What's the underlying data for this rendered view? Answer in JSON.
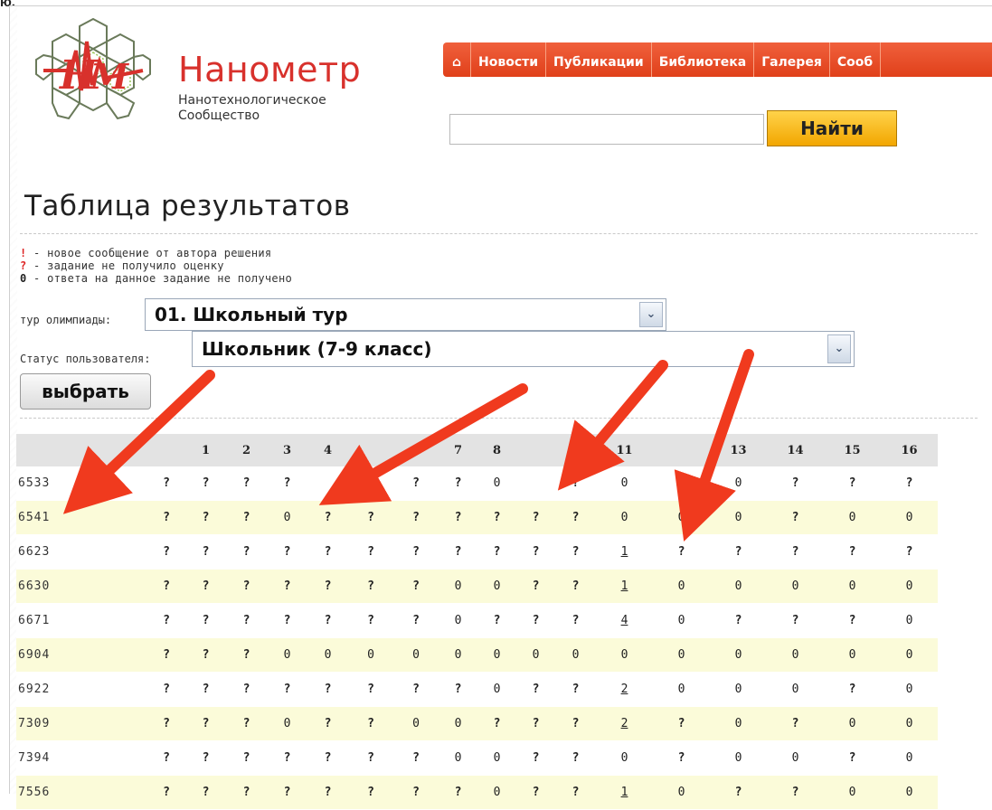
{
  "page": {
    "colors": {
      "accent": "#d8312c",
      "nav": "#e84c22",
      "row_alt": "#fbfbd9",
      "mark_red": "#dd2222",
      "link": "#2233bb"
    }
  },
  "header": {
    "stub_text": "ю.",
    "brand": "Нанометр",
    "brand_sub_line1": "Нанотехнологическое",
    "brand_sub_line2": "Сообщество",
    "logo_icon": "nanometer-logo"
  },
  "nav": {
    "home_icon": "home-icon",
    "items": [
      "Новости",
      "Публикации",
      "Библиотека",
      "Галерея",
      "Сооб"
    ]
  },
  "search": {
    "value": "",
    "button_label": "Найти"
  },
  "main": {
    "title": "Таблица результатов",
    "legend": [
      {
        "mark": "!",
        "text": " - новое сообщение от автора решения"
      },
      {
        "mark": "?",
        "text": " - задание не получило оценку"
      },
      {
        "mark": "0",
        "text": " - ответа на данное задание не получено"
      }
    ],
    "filter_round_label": "тур олимпиады:",
    "filter_round_value": "01. Школьный тур",
    "filter_status_label": "Статус пользователя:",
    "filter_status_value": "Школьник (7-9 класс)",
    "choose_button": "выбрать"
  },
  "table": {
    "headers": [
      "",
      "",
      "1",
      "2",
      "3",
      "4",
      "",
      "6",
      "7",
      "8",
      "",
      "",
      "11",
      "",
      "13",
      "14",
      "15",
      "16"
    ],
    "rows": [
      {
        "id": "6533",
        "cells": [
          "?",
          "?",
          "?",
          "?",
          "",
          "",
          "?",
          "?",
          "0",
          "",
          "?",
          "0",
          "?",
          "0",
          "?",
          "?",
          "?"
        ]
      },
      {
        "id": "6541",
        "cells": [
          "?",
          "?",
          "?",
          "0",
          "?",
          "?",
          "?",
          "?",
          "?",
          "?",
          "?",
          "0",
          "0",
          "0",
          "?",
          "0",
          "0"
        ]
      },
      {
        "id": "6623",
        "cells": [
          "?",
          "?",
          "?",
          "?",
          "?",
          "?",
          "?",
          "?",
          "?",
          "?",
          "?",
          "1",
          "?",
          "?",
          "?",
          "?",
          "?"
        ]
      },
      {
        "id": "6630",
        "cells": [
          "?",
          "?",
          "?",
          "?",
          "?",
          "?",
          "?",
          "0",
          "0",
          "?",
          "?",
          "1",
          "0",
          "0",
          "0",
          "0",
          "0"
        ]
      },
      {
        "id": "6671",
        "cells": [
          "?",
          "?",
          "?",
          "?",
          "?",
          "?",
          "?",
          "0",
          "?",
          "?",
          "?",
          "4",
          "0",
          "?",
          "?",
          "?",
          "0"
        ]
      },
      {
        "id": "6904",
        "cells": [
          "?",
          "?",
          "?",
          "0",
          "0",
          "0",
          "0",
          "0",
          "0",
          "0",
          "0",
          "0",
          "0",
          "0",
          "0",
          "0",
          "0"
        ]
      },
      {
        "id": "6922",
        "cells": [
          "?",
          "?",
          "?",
          "?",
          "?",
          "?",
          "?",
          "?",
          "0",
          "?",
          "?",
          "2",
          "0",
          "0",
          "0",
          "?",
          "0"
        ]
      },
      {
        "id": "7309",
        "cells": [
          "?",
          "?",
          "?",
          "0",
          "?",
          "?",
          "0",
          "0",
          "?",
          "?",
          "?",
          "2",
          "?",
          "0",
          "?",
          "0",
          "0"
        ]
      },
      {
        "id": "7394",
        "cells": [
          "?",
          "?",
          "?",
          "?",
          "?",
          "?",
          "?",
          "0",
          "0",
          "?",
          "?",
          "0",
          "?",
          "0",
          "0",
          "?",
          "0"
        ]
      },
      {
        "id": "7556",
        "cells": [
          "?",
          "?",
          "?",
          "?",
          "?",
          "?",
          "?",
          "?",
          "0",
          "?",
          "?",
          "1",
          "0",
          "?",
          "?",
          "0",
          "0"
        ]
      }
    ]
  }
}
